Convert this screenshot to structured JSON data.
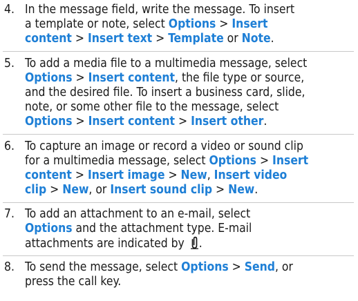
{
  "steps": [
    {
      "number": "4.",
      "lines": [
        [
          {
            "t": "In the message field, write the message. To insert"
          }
        ],
        [
          {
            "t": "a template or note, select "
          },
          {
            "t": "Options",
            "k": 1
          },
          {
            "t": " > ",
            "s": 1
          },
          {
            "t": "Insert",
            "k": 1
          }
        ],
        [
          {
            "t": "content",
            "k": 1
          },
          {
            "t": " > ",
            "s": 1
          },
          {
            "t": "Insert text",
            "k": 1
          },
          {
            "t": " > ",
            "s": 1
          },
          {
            "t": "Template",
            "k": 1
          },
          {
            "t": " or "
          },
          {
            "t": "Note",
            "k": 1
          },
          {
            "t": "."
          }
        ]
      ]
    },
    {
      "number": "5.",
      "lines": [
        [
          {
            "t": "To add a media file to a multimedia message, select"
          }
        ],
        [
          {
            "t": "Options",
            "k": 1
          },
          {
            "t": " > ",
            "s": 1
          },
          {
            "t": "Insert content",
            "k": 1
          },
          {
            "t": ", the file type or source,"
          }
        ],
        [
          {
            "t": "and the desired file. To insert a business card, slide,"
          }
        ],
        [
          {
            "t": "note, or some other file to the message, select"
          }
        ],
        [
          {
            "t": "Options",
            "k": 1
          },
          {
            "t": " > ",
            "s": 1
          },
          {
            "t": "Insert content",
            "k": 1
          },
          {
            "t": " > ",
            "s": 1
          },
          {
            "t": "Insert other",
            "k": 1
          },
          {
            "t": "."
          }
        ]
      ]
    },
    {
      "number": "6.",
      "lines": [
        [
          {
            "t": "To capture an image or record a video or sound clip"
          }
        ],
        [
          {
            "t": "for a multimedia message, select "
          },
          {
            "t": "Options",
            "k": 1
          },
          {
            "t": " > ",
            "s": 1
          },
          {
            "t": "Insert",
            "k": 1
          }
        ],
        [
          {
            "t": "content",
            "k": 1
          },
          {
            "t": " > ",
            "s": 1
          },
          {
            "t": "Insert image",
            "k": 1
          },
          {
            "t": " > ",
            "s": 1
          },
          {
            "t": "New",
            "k": 1
          },
          {
            "t": ", "
          },
          {
            "t": "Insert video",
            "k": 1
          }
        ],
        [
          {
            "t": "clip",
            "k": 1
          },
          {
            "t": " > ",
            "s": 1
          },
          {
            "t": "New",
            "k": 1
          },
          {
            "t": ", or "
          },
          {
            "t": "Insert sound clip",
            "k": 1
          },
          {
            "t": " > ",
            "s": 1
          },
          {
            "t": "New",
            "k": 1
          },
          {
            "t": "."
          }
        ]
      ]
    },
    {
      "number": "7.",
      "lines": [
        [
          {
            "t": "To add an attachment to an e-mail, select"
          }
        ],
        [
          {
            "t": "Options",
            "k": 1
          },
          {
            "t": " and the attachment type. E-mail"
          }
        ],
        [
          {
            "t": "attachments are indicated by "
          },
          {
            "icon": "paperclip-icon"
          },
          {
            "t": "."
          }
        ]
      ]
    },
    {
      "number": "8.",
      "lines": [
        [
          {
            "t": "To send the message, select "
          },
          {
            "t": "Options",
            "k": 1
          },
          {
            "t": " > ",
            "s": 1
          },
          {
            "t": "Send",
            "k": 1
          },
          {
            "t": ", or"
          }
        ],
        [
          {
            "t": "press the call key."
          }
        ]
      ]
    }
  ],
  "colors": {
    "keyword": "#1e7fd6",
    "text": "#1a1a1a",
    "divider": "#c8c8c8"
  }
}
